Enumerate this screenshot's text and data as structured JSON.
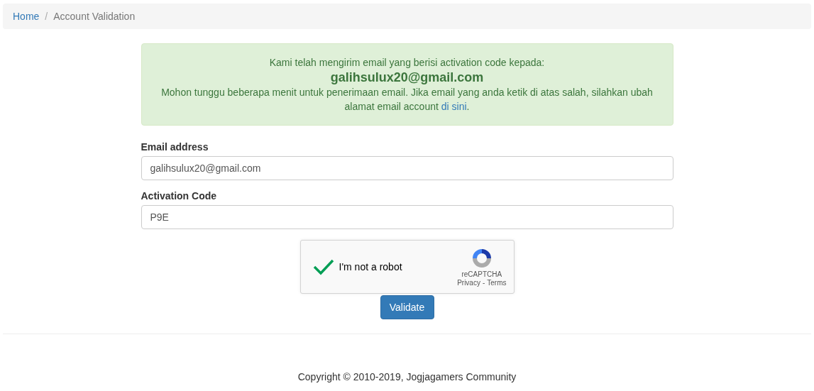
{
  "breadcrumb": [
    {
      "label": "Home",
      "kind": "link"
    },
    {
      "label": "/",
      "kind": "separator"
    },
    {
      "label": "Account Validation",
      "kind": "current"
    }
  ],
  "alert": {
    "intro": "Kami telah mengirim email yang berisi activation code kepada:",
    "email": "galihsulux20@gmail.com",
    "message": "Mohon tunggu beberapa menit untuk penerimaan email. Jika email yang anda ketik di atas salah, silahkan ubah alamat email account ",
    "link": "di sini",
    "message_end": "."
  },
  "fields": [
    {
      "label": "Email address",
      "value": "galihsulux20@gmail.com"
    },
    {
      "label": "Activation Code",
      "value": "P9E"
    }
  ],
  "captcha": {
    "label": "I'm not a robot",
    "checked": true,
    "brand": "reCAPTCHA",
    "privacy": "Privacy",
    "separator": "-",
    "terms": "Terms"
  },
  "button": "Validate",
  "footer": "Copyright © 2010-2019, Jogjagamers Community"
}
